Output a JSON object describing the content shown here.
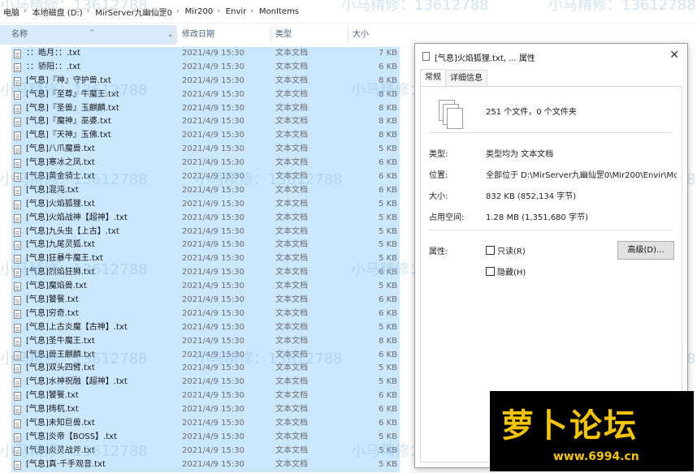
{
  "breadcrumb": [
    "电脑",
    "本地磁盘 (D:)",
    "MirServer九幽仙罡0",
    "Mir200",
    "Envir",
    "MonItems"
  ],
  "columns": {
    "name": "名称",
    "date": "修改日期",
    "type": "类型",
    "size": "大小"
  },
  "files": [
    {
      "name": "：：皓月：：.txt",
      "date": "2021/4/9 15:30",
      "type": "文本文档",
      "size": "7 KB"
    },
    {
      "name": "：：骄阳：：.txt",
      "date": "2021/4/9 15:30",
      "type": "文本文档",
      "size": "6 KB"
    },
    {
      "name": "[气息]『神』守护兽.txt",
      "date": "2021/4/9 15:30",
      "type": "文本文档",
      "size": "8 KB"
    },
    {
      "name": "[气息]『至尊』牛魔王.txt",
      "date": "2021/4/9 15:30",
      "type": "文本文档",
      "size": "8 KB"
    },
    {
      "name": "[气息]『圣兽』玉麒麟.txt",
      "date": "2021/4/9 15:30",
      "type": "文本文档",
      "size": "8 KB"
    },
    {
      "name": "[气息]『魔神』巫婆.txt",
      "date": "2021/4/9 15:30",
      "type": "文本文档",
      "size": "8 KB"
    },
    {
      "name": "[气息]『天神』玉佛.txt",
      "date": "2021/4/9 15:30",
      "type": "文本文档",
      "size": "8 KB"
    },
    {
      "name": "[气息]八爪魔兽.txt",
      "date": "2021/4/9 15:30",
      "type": "文本文档",
      "size": "5 KB"
    },
    {
      "name": "[气息]寒冰之凤.txt",
      "date": "2021/4/9 15:30",
      "type": "文本文档",
      "size": "6 KB"
    },
    {
      "name": "[气息]黄金骑士.txt",
      "date": "2021/4/9 15:30",
      "type": "文本文档",
      "size": "6 KB"
    },
    {
      "name": "[气息]混沌.txt",
      "date": "2021/4/9 15:30",
      "type": "文本文档",
      "size": "6 KB"
    },
    {
      "name": "[气息]火焰狐狸.txt",
      "date": "2021/4/9 15:30",
      "type": "文本文档",
      "size": "5 KB"
    },
    {
      "name": "[气息]火焰战神【超神】.txt",
      "date": "2021/4/9 15:30",
      "type": "文本文档",
      "size": "5 KB"
    },
    {
      "name": "[气息]九头虫【上古】.txt",
      "date": "2021/4/9 15:30",
      "type": "文本文档",
      "size": "5 KB"
    },
    {
      "name": "[气息]九尾灵狐.txt",
      "date": "2021/4/9 15:30",
      "type": "文本文档",
      "size": "5 KB"
    },
    {
      "name": "[气息]狂暴牛魔王.txt",
      "date": "2021/4/9 15:30",
      "type": "文本文档",
      "size": "5 KB"
    },
    {
      "name": "[气息]烈焰狂狮.txt",
      "date": "2021/4/9 15:30",
      "type": "文本文档",
      "size": "6 KB"
    },
    {
      "name": "[气息]魔焰兽.txt",
      "date": "2021/4/9 15:30",
      "type": "文本文档",
      "size": "5 KB"
    },
    {
      "name": "[气息]饕餮.txt",
      "date": "2021/4/9 15:30",
      "type": "文本文档",
      "size": "6 KB"
    },
    {
      "name": "[气息]穷奇.txt",
      "date": "2021/4/9 15:30",
      "type": "文本文档",
      "size": "6 KB"
    },
    {
      "name": "[气息]上古炎魔【古神】.txt",
      "date": "2021/4/9 15:30",
      "type": "文本文档",
      "size": "5 KB"
    },
    {
      "name": "[气息]圣牛魔王.txt",
      "date": "2021/4/9 15:30",
      "type": "文本文档",
      "size": "8 KB"
    },
    {
      "name": "[气息]兽王麒麟.txt",
      "date": "2021/4/9 15:30",
      "type": "文本文档",
      "size": "6 KB"
    },
    {
      "name": "[气息]双头四臂.txt",
      "date": "2021/4/9 15:30",
      "type": "文本文档",
      "size": "5 KB"
    },
    {
      "name": "[气息]水神祝融【超神】.txt",
      "date": "2021/4/9 15:30",
      "type": "文本文档",
      "size": "5 KB"
    },
    {
      "name": "[气息]饕餮.txt",
      "date": "2021/4/9 15:30",
      "type": "文本文档",
      "size": "6 KB"
    },
    {
      "name": "[气息]梼杌.txt",
      "date": "2021/4/9 15:30",
      "type": "文本文档",
      "size": "6 KB"
    },
    {
      "name": "[气息]未知巨兽.txt",
      "date": "2021/4/9 15:30",
      "type": "文本文档",
      "size": "6 KB"
    },
    {
      "name": "[气息]炎帝【BOSS】.txt",
      "date": "2021/4/9 15:30",
      "type": "文本文档",
      "size": "5 KB"
    },
    {
      "name": "[气息]炎灵战斧.txt",
      "date": "2021/4/9 15:30",
      "type": "文本文档",
      "size": "5 KB"
    },
    {
      "name": "[气息]真·千手观音.txt",
      "date": "2021/4/9 15:30",
      "type": "文本文档",
      "size": "5 KB"
    }
  ],
  "dialog": {
    "title": "[气息]火焰狐狸.txt, ... 属性",
    "close": "✕",
    "tabs": [
      "常规",
      "详细信息"
    ],
    "summary": "251 个文件，0 个文件夹",
    "type_label": "类型:",
    "type_value": "类型均为 文本文档",
    "location_label": "位置:",
    "location_value": "全部位于 D:\\MirServer九幽仙罡0\\Mir200\\Envir\\Mo",
    "size_label": "大小:",
    "size_value": "832 KB (852,134 字节)",
    "ondisk_label": "占用空间:",
    "ondisk_value": "1.28 MB (1,351,680 字节)",
    "attr_label": "属性:",
    "readonly": "只读(R)",
    "hidden": "隐藏(H)",
    "advanced": "高级(D)..."
  },
  "watermark": "小马精修：13612788",
  "logo": {
    "big": "萝卜论坛",
    "url": "www.6994.cn"
  }
}
